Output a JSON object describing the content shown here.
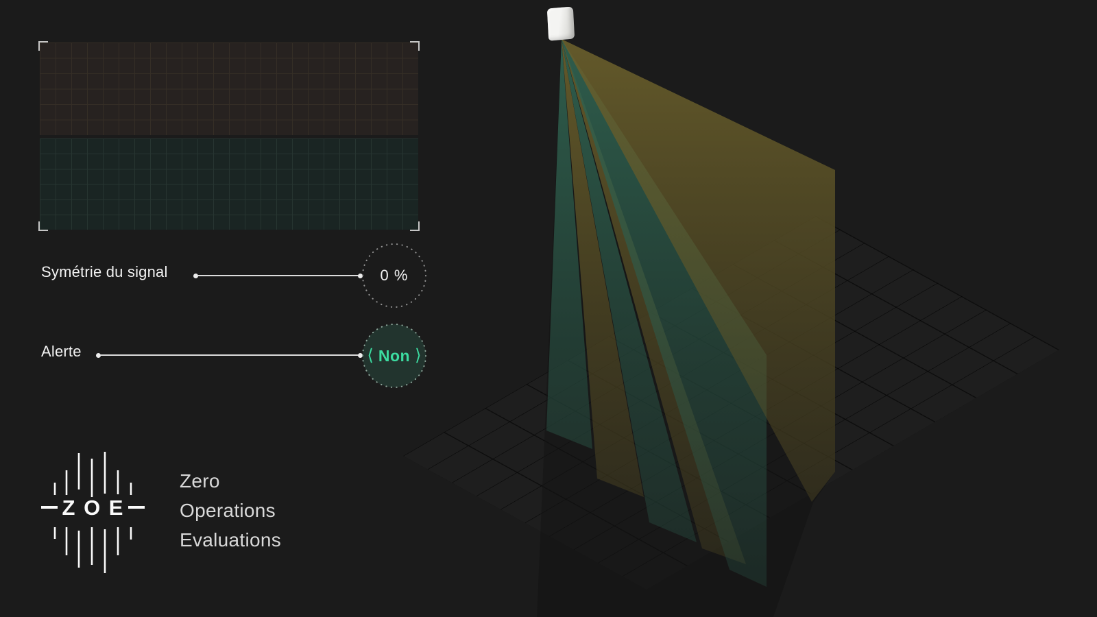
{
  "app": {
    "background": "#1b1b1b",
    "accent_green": "#3cdca1"
  },
  "signal_panel": {
    "top_fill": "#272220",
    "top_gridline": "#352e26",
    "bottom_fill": "#1a2523",
    "bottom_gridline": "#273531",
    "columns": 24,
    "rows_per_half": 6,
    "content": "empty-signal-grid"
  },
  "controls": {
    "symmetry": {
      "label": "Symétrie du signal",
      "value": "0 %"
    },
    "alert": {
      "label": "Alerte",
      "value": "Non",
      "prev_icon": "⟨",
      "next_icon": "⟩"
    }
  },
  "logo": {
    "mark": "Z O E",
    "lines": [
      "Zero",
      "Operations",
      "Evaluations"
    ]
  },
  "scene": {
    "device": "ceiling-mounted-sensor",
    "beam_teal": "#2f5f4e",
    "beam_olive": "#655a29",
    "beam_pattern": [
      "teal",
      "olive",
      "teal",
      "olive",
      "teal",
      "olive"
    ],
    "floor_grid": "10x10 isometric"
  }
}
